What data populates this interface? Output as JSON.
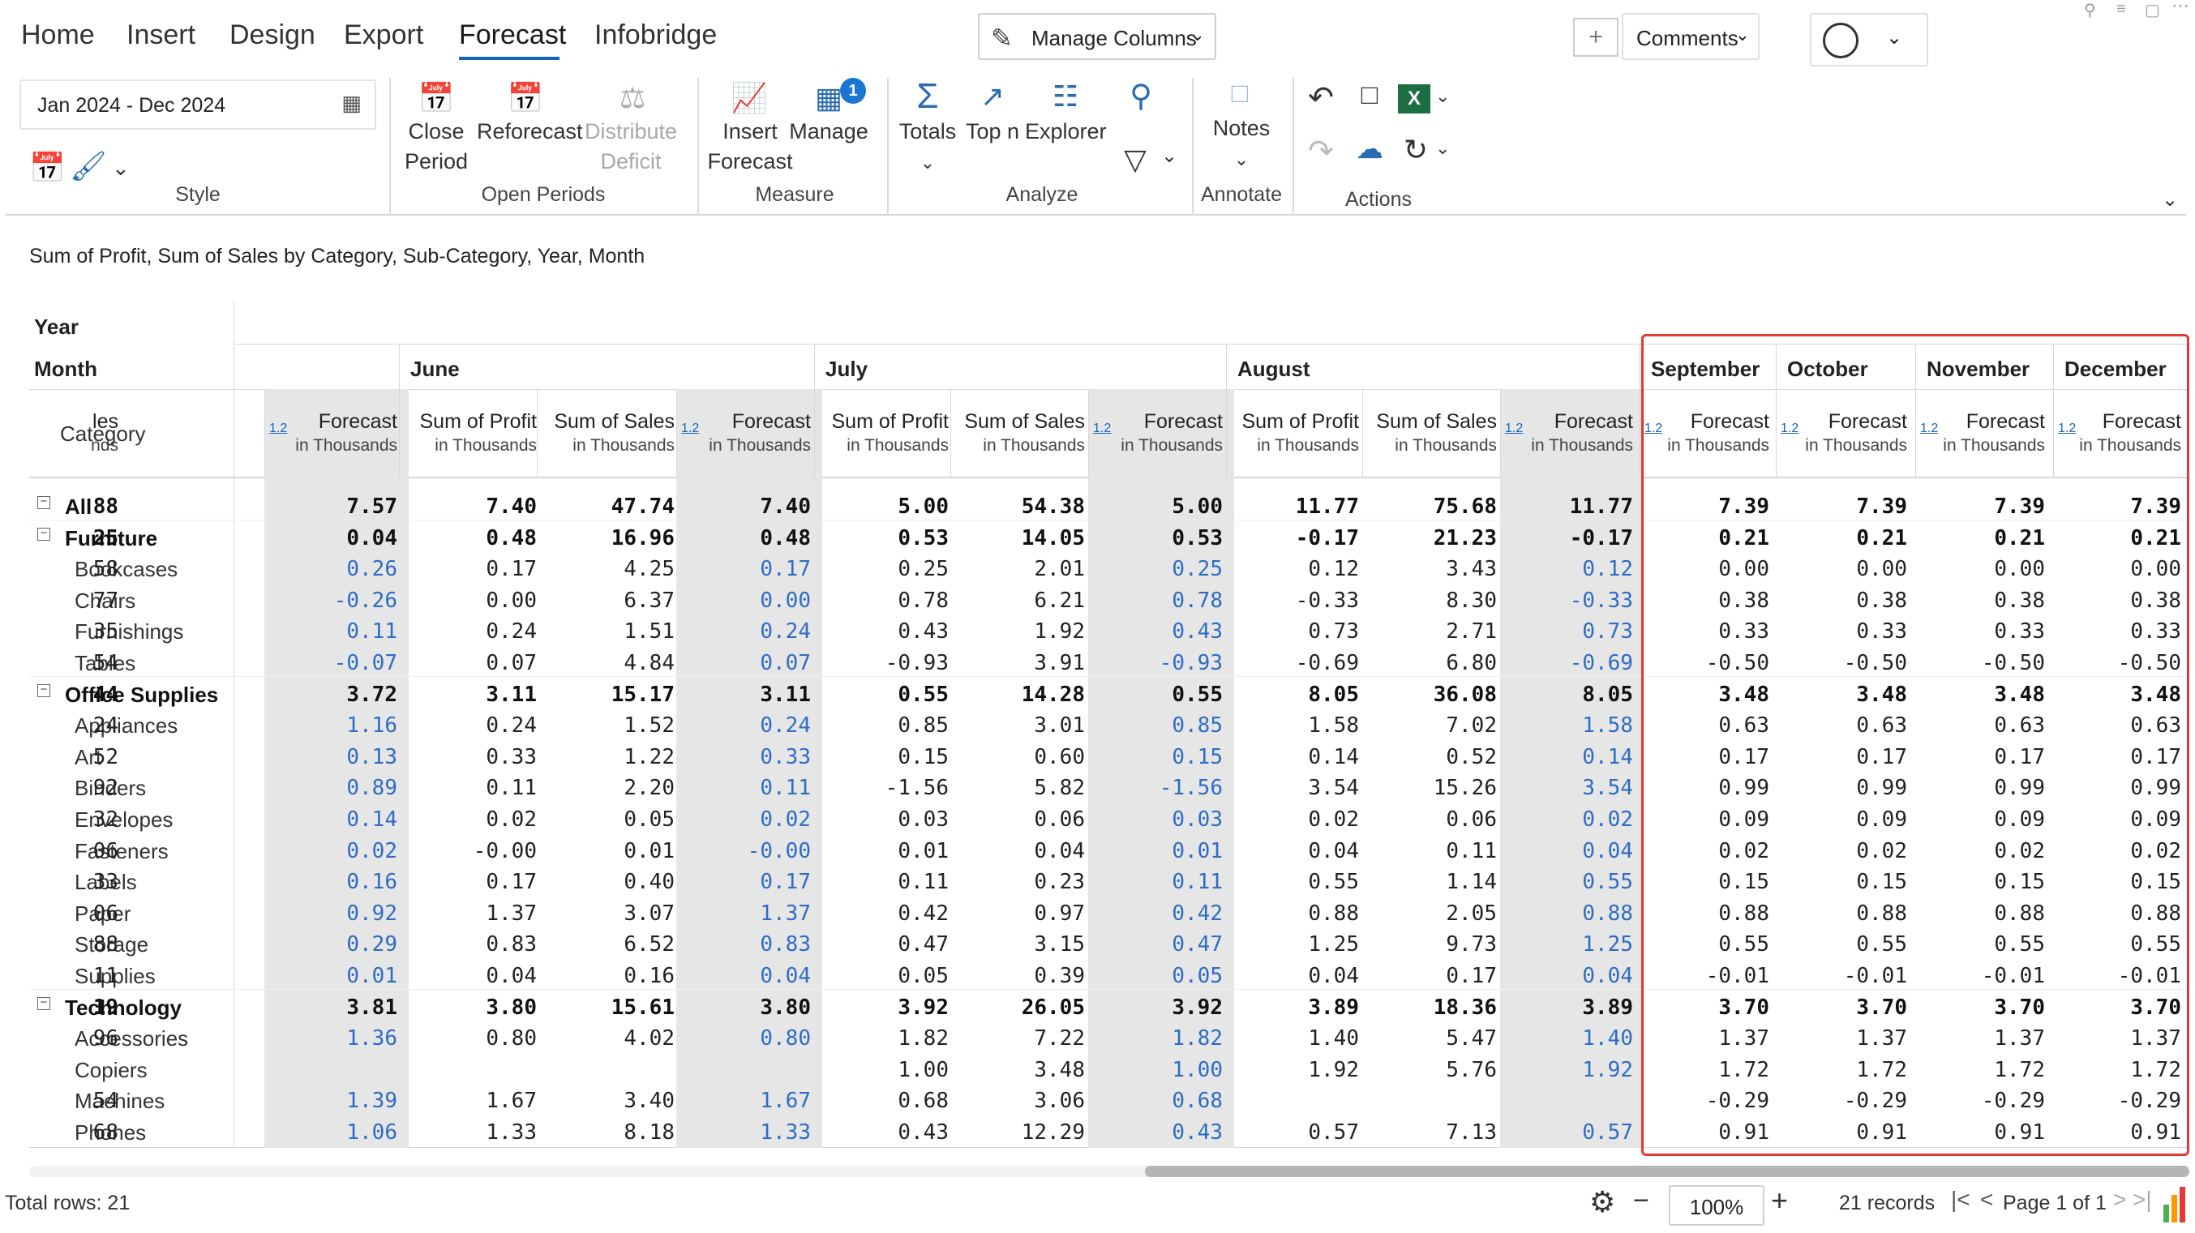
{
  "tabs": [
    "Home",
    "Insert",
    "Design",
    "Export",
    "Forecast",
    "Infobridge"
  ],
  "active_tab": "Forecast",
  "date_range": "Jan 2024 - Dec 2024",
  "manage_columns": "Manage Columns",
  "comments": "Comments",
  "groups": {
    "style": "Style",
    "open_periods": "Open Periods",
    "measure": "Measure",
    "analyze": "Analyze",
    "annotate": "Annotate",
    "actions": "Actions"
  },
  "buttons": {
    "close_period_1": "Close",
    "close_period_2": "Period",
    "reforecast": "Reforecast",
    "distribute_1": "Distribute",
    "distribute_2": "Deficit",
    "insert_1": "Insert",
    "insert_2": "Forecast",
    "manage": "Manage",
    "manage_badge": "1",
    "totals": "Totals",
    "topn": "Top n",
    "explorer": "Explorer",
    "notes": "Notes"
  },
  "caption": "Sum of Profit, Sum of Sales by Category, Sub-Category, Year, Month",
  "grid": {
    "year_label": "Year",
    "month_label": "Month",
    "category_label": "Category",
    "badge": "1.2",
    "months": [
      "June",
      "July",
      "August",
      "September",
      "October",
      "November",
      "December"
    ],
    "col_sales_partial": "les",
    "col_sales_partial_sub": "nds",
    "col_profit": "Sum of Profit",
    "col_sales": "Sum of Sales",
    "col_forecast": "Forecast",
    "col_sub": "in Thousands",
    "rows": [
      {
        "label": "All",
        "level": 0,
        "bold": true,
        "v": [
          "88",
          "7.57",
          "7.40",
          "47.74",
          "7.40",
          "5.00",
          "54.38",
          "5.00",
          "11.77",
          "75.68",
          "11.77",
          "7.39",
          "7.39",
          "7.39",
          "7.39"
        ]
      },
      {
        "label": "Furniture",
        "level": 0,
        "bold": true,
        "v": [
          "25",
          "0.04",
          "0.48",
          "16.96",
          "0.48",
          "0.53",
          "14.05",
          "0.53",
          "-0.17",
          "21.23",
          "-0.17",
          "0.21",
          "0.21",
          "0.21",
          "0.21"
        ]
      },
      {
        "label": "Bookcases",
        "level": 1,
        "v": [
          "58",
          "0.26",
          "0.17",
          "4.25",
          "0.17",
          "0.25",
          "2.01",
          "0.25",
          "0.12",
          "3.43",
          "0.12",
          "0.00",
          "0.00",
          "0.00",
          "0.00"
        ]
      },
      {
        "label": "Chairs",
        "level": 1,
        "v": [
          "77",
          "-0.26",
          "0.00",
          "6.37",
          "0.00",
          "0.78",
          "6.21",
          "0.78",
          "-0.33",
          "8.30",
          "-0.33",
          "0.38",
          "0.38",
          "0.38",
          "0.38"
        ]
      },
      {
        "label": "Furnishings",
        "level": 1,
        "v": [
          "35",
          "0.11",
          "0.24",
          "1.51",
          "0.24",
          "0.43",
          "1.92",
          "0.43",
          "0.73",
          "2.71",
          "0.73",
          "0.33",
          "0.33",
          "0.33",
          "0.33"
        ]
      },
      {
        "label": "Tables",
        "level": 1,
        "v": [
          "54",
          "-0.07",
          "0.07",
          "4.84",
          "0.07",
          "-0.93",
          "3.91",
          "-0.93",
          "-0.69",
          "6.80",
          "-0.69",
          "-0.50",
          "-0.50",
          "-0.50",
          "-0.50"
        ]
      },
      {
        "label": "Office Supplies",
        "level": 0,
        "bold": true,
        "v": [
          "44",
          "3.72",
          "3.11",
          "15.17",
          "3.11",
          "0.55",
          "14.28",
          "0.55",
          "8.05",
          "36.08",
          "8.05",
          "3.48",
          "3.48",
          "3.48",
          "3.48"
        ]
      },
      {
        "label": "Appliances",
        "level": 1,
        "v": [
          "24",
          "1.16",
          "0.24",
          "1.52",
          "0.24",
          "0.85",
          "3.01",
          "0.85",
          "1.58",
          "7.02",
          "1.58",
          "0.63",
          "0.63",
          "0.63",
          "0.63"
        ]
      },
      {
        "label": "Art",
        "level": 1,
        "v": [
          "52",
          "0.13",
          "0.33",
          "1.22",
          "0.33",
          "0.15",
          "0.60",
          "0.15",
          "0.14",
          "0.52",
          "0.14",
          "0.17",
          "0.17",
          "0.17",
          "0.17"
        ]
      },
      {
        "label": "Binders",
        "level": 1,
        "v": [
          "92",
          "0.89",
          "0.11",
          "2.20",
          "0.11",
          "-1.56",
          "5.82",
          "-1.56",
          "3.54",
          "15.26",
          "3.54",
          "0.99",
          "0.99",
          "0.99",
          "0.99"
        ]
      },
      {
        "label": "Envelopes",
        "level": 1,
        "v": [
          "32",
          "0.14",
          "0.02",
          "0.05",
          "0.02",
          "0.03",
          "0.06",
          "0.03",
          "0.02",
          "0.06",
          "0.02",
          "0.09",
          "0.09",
          "0.09",
          "0.09"
        ]
      },
      {
        "label": "Fasteners",
        "level": 1,
        "v": [
          "06",
          "0.02",
          "-0.00",
          "0.01",
          "-0.00",
          "0.01",
          "0.04",
          "0.01",
          "0.04",
          "0.11",
          "0.04",
          "0.02",
          "0.02",
          "0.02",
          "0.02"
        ]
      },
      {
        "label": "Labels",
        "level": 1,
        "v": [
          "33",
          "0.16",
          "0.17",
          "0.40",
          "0.17",
          "0.11",
          "0.23",
          "0.11",
          "0.55",
          "1.14",
          "0.55",
          "0.15",
          "0.15",
          "0.15",
          "0.15"
        ]
      },
      {
        "label": "Paper",
        "level": 1,
        "v": [
          "06",
          "0.92",
          "1.37",
          "3.07",
          "1.37",
          "0.42",
          "0.97",
          "0.42",
          "0.88",
          "2.05",
          "0.88",
          "0.88",
          "0.88",
          "0.88",
          "0.88"
        ]
      },
      {
        "label": "Storage",
        "level": 1,
        "v": [
          "88",
          "0.29",
          "0.83",
          "6.52",
          "0.83",
          "0.47",
          "3.15",
          "0.47",
          "1.25",
          "9.73",
          "1.25",
          "0.55",
          "0.55",
          "0.55",
          "0.55"
        ]
      },
      {
        "label": "Supplies",
        "level": 1,
        "v": [
          "11",
          "0.01",
          "0.04",
          "0.16",
          "0.04",
          "0.05",
          "0.39",
          "0.05",
          "0.04",
          "0.17",
          "0.04",
          "-0.01",
          "-0.01",
          "-0.01",
          "-0.01"
        ]
      },
      {
        "label": "Technology",
        "level": 0,
        "bold": true,
        "v": [
          "19",
          "3.81",
          "3.80",
          "15.61",
          "3.80",
          "3.92",
          "26.05",
          "3.92",
          "3.89",
          "18.36",
          "3.89",
          "3.70",
          "3.70",
          "3.70",
          "3.70"
        ]
      },
      {
        "label": "Accessories",
        "level": 1,
        "v": [
          "96",
          "1.36",
          "0.80",
          "4.02",
          "0.80",
          "1.82",
          "7.22",
          "1.82",
          "1.40",
          "5.47",
          "1.40",
          "1.37",
          "1.37",
          "1.37",
          "1.37"
        ]
      },
      {
        "label": "Copiers",
        "level": 1,
        "v": [
          "",
          "",
          "",
          "",
          "",
          "1.00",
          "3.48",
          "1.00",
          "1.92",
          "5.76",
          "1.92",
          "1.72",
          "1.72",
          "1.72",
          "1.72"
        ]
      },
      {
        "label": "Machines",
        "level": 1,
        "v": [
          "54",
          "1.39",
          "1.67",
          "3.40",
          "1.67",
          "0.68",
          "3.06",
          "0.68",
          "",
          "",
          "",
          "-0.29",
          "-0.29",
          "-0.29",
          "-0.29"
        ]
      },
      {
        "label": "Phones",
        "level": 1,
        "v": [
          "68",
          "1.06",
          "1.33",
          "8.18",
          "1.33",
          "0.43",
          "12.29",
          "0.43",
          "0.57",
          "7.13",
          "0.57",
          "0.91",
          "0.91",
          "0.91",
          "0.91"
        ]
      }
    ]
  },
  "footer": {
    "total_rows": "Total rows: 21",
    "zoom": "100%",
    "records": "21 records",
    "page": "Page 1 of 1"
  }
}
